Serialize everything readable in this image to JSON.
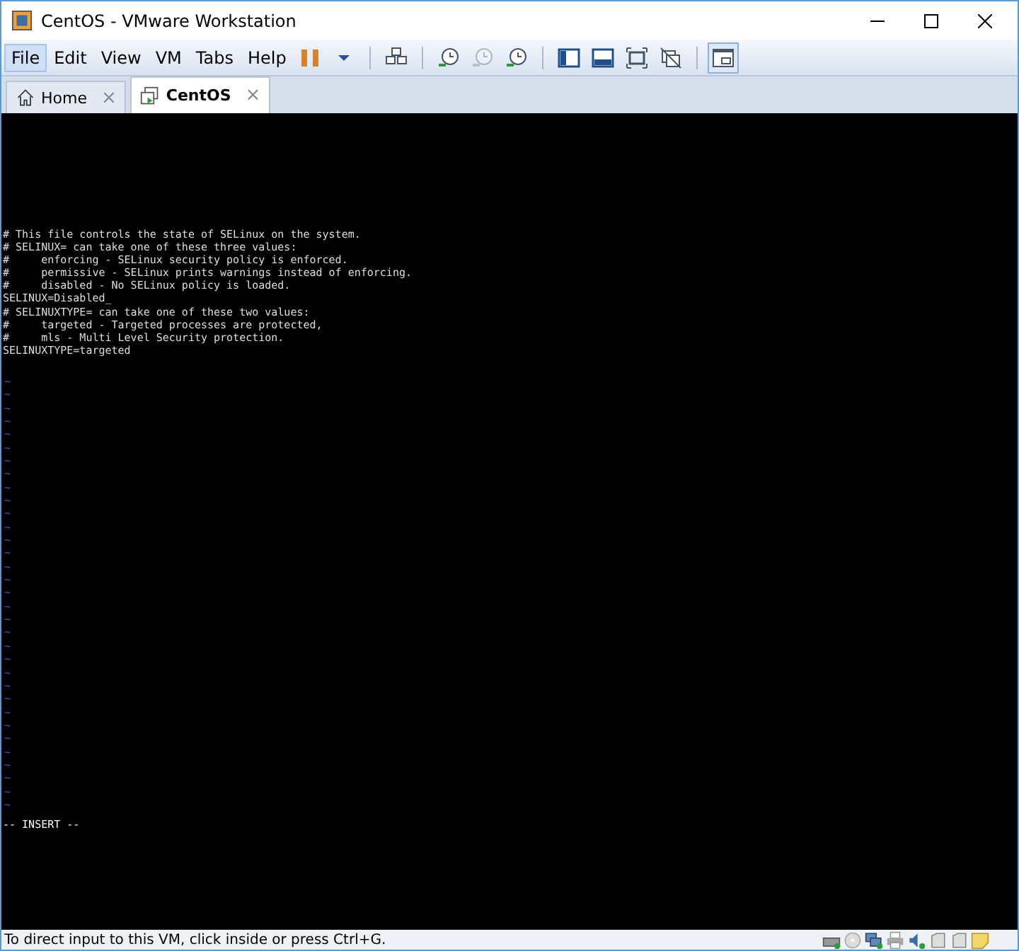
{
  "window": {
    "title": "CentOS - VMware Workstation"
  },
  "menu": [
    {
      "label": "File",
      "selected": true
    },
    {
      "label": "Edit",
      "selected": false
    },
    {
      "label": "View",
      "selected": false
    },
    {
      "label": "VM",
      "selected": false
    },
    {
      "label": "Tabs",
      "selected": false
    },
    {
      "label": "Help",
      "selected": false
    }
  ],
  "toolbar": [
    {
      "kind": "pause",
      "disabled": false,
      "selected": false
    },
    {
      "kind": "caret",
      "disabled": false,
      "selected": false
    },
    {
      "kind": "sep"
    },
    {
      "kind": "send",
      "disabled": false,
      "selected": false
    },
    {
      "kind": "sep"
    },
    {
      "kind": "snap",
      "disabled": false,
      "selected": false
    },
    {
      "kind": "revert",
      "disabled": true,
      "selected": false
    },
    {
      "kind": "manage",
      "disabled": false,
      "selected": false
    },
    {
      "kind": "sep"
    },
    {
      "kind": "library",
      "disabled": false,
      "selected": false
    },
    {
      "kind": "thumb",
      "disabled": false,
      "selected": false
    },
    {
      "kind": "full",
      "disabled": false,
      "selected": false
    },
    {
      "kind": "unity",
      "disabled": false,
      "selected": false
    },
    {
      "kind": "sep"
    },
    {
      "kind": "console",
      "disabled": false,
      "selected": true
    }
  ],
  "tabs": [
    {
      "label": "Home",
      "kind": "home",
      "selected": false,
      "close": "×"
    },
    {
      "label": "CentOS",
      "kind": "vm",
      "selected": true,
      "close": "×"
    }
  ],
  "console": {
    "lines": [
      "# This file controls the state of SELinux on the system.",
      "# SELINUX= can take one of these three values:",
      "#     enforcing - SELinux security policy is enforced.",
      "#     permissive - SELinux prints warnings instead of enforcing.",
      "#     disabled - No SELinux policy is loaded.",
      "SELINUX=Disabled_",
      "# SELINUXTYPE= can take one of these two values:",
      "#     targeted - Targeted processes are protected,",
      "#     mls - Multi Level Security protection.",
      "SELINUXTYPE=targeted"
    ],
    "tildes": [
      "~",
      "~",
      "~",
      "~",
      "~",
      "~",
      "~",
      "~",
      "~",
      "~",
      "~",
      "~",
      "~",
      "~",
      "~",
      "~",
      "~",
      "~",
      "~",
      "~",
      "~",
      "~",
      "~",
      "~",
      "~",
      "~",
      "~",
      "~",
      "~",
      "~",
      "~",
      "~",
      "~"
    ],
    "mode": "-- INSERT --"
  },
  "status_bar": {
    "text": "To direct input to this VM, click inside or press Ctrl+G.",
    "devices": [
      {
        "kind": "hdd"
      },
      {
        "kind": "cd"
      },
      {
        "kind": "net"
      },
      {
        "kind": "printer"
      },
      {
        "kind": "sound"
      },
      {
        "kind": "usb"
      },
      {
        "kind": "usb"
      },
      {
        "kind": "note"
      }
    ]
  }
}
